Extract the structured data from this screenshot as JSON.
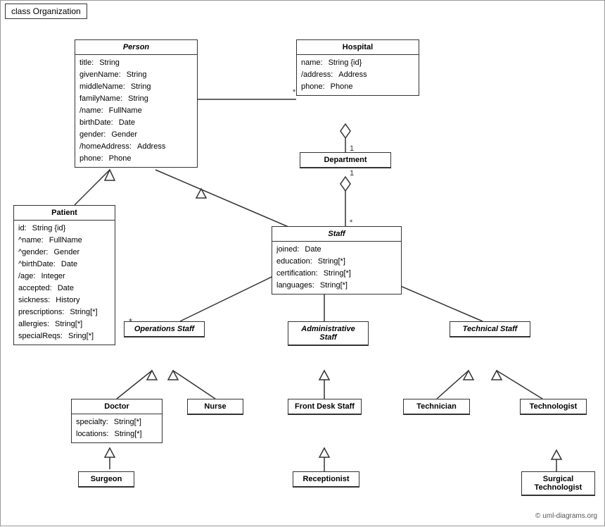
{
  "title": "class Organization",
  "copyright": "© uml-diagrams.org",
  "boxes": {
    "person": {
      "title": "Person",
      "italic": true,
      "attrs": [
        {
          "name": "title:",
          "type": "String"
        },
        {
          "name": "givenName:",
          "type": "String"
        },
        {
          "name": "middleName:",
          "type": "String"
        },
        {
          "name": "familyName:",
          "type": "String"
        },
        {
          "name": "/name:",
          "type": "FullName"
        },
        {
          "name": "birthDate:",
          "type": "Date"
        },
        {
          "name": "gender:",
          "type": "Gender"
        },
        {
          "name": "/homeAddress:",
          "type": "Address"
        },
        {
          "name": "phone:",
          "type": "Phone"
        }
      ]
    },
    "hospital": {
      "title": "Hospital",
      "attrs": [
        {
          "name": "name:",
          "type": "String {id}"
        },
        {
          "name": "/address:",
          "type": "Address"
        },
        {
          "name": "phone:",
          "type": "Phone"
        }
      ]
    },
    "patient": {
      "title": "Patient",
      "attrs": [
        {
          "name": "id:",
          "type": "String {id}"
        },
        {
          "name": "^name:",
          "type": "FullName"
        },
        {
          "name": "^gender:",
          "type": "Gender"
        },
        {
          "name": "^birthDate:",
          "type": "Date"
        },
        {
          "name": "/age:",
          "type": "Integer"
        },
        {
          "name": "accepted:",
          "type": "Date"
        },
        {
          "name": "sickness:",
          "type": "History"
        },
        {
          "name": "prescriptions:",
          "type": "String[*]"
        },
        {
          "name": "allergies:",
          "type": "String[*]"
        },
        {
          "name": "specialReqs:",
          "type": "Sring[*]"
        }
      ]
    },
    "department": {
      "title": "Department",
      "attrs": []
    },
    "staff": {
      "title": "Staff",
      "italic": true,
      "attrs": [
        {
          "name": "joined:",
          "type": "Date"
        },
        {
          "name": "education:",
          "type": "String[*]"
        },
        {
          "name": "certification:",
          "type": "String[*]"
        },
        {
          "name": "languages:",
          "type": "String[*]"
        }
      ]
    },
    "operations_staff": {
      "title": "Operations Staff",
      "italic": true,
      "attrs": []
    },
    "administrative_staff": {
      "title": "Administrative Staff",
      "italic": true,
      "attrs": []
    },
    "technical_staff": {
      "title": "Technical Staff",
      "italic": true,
      "attrs": []
    },
    "doctor": {
      "title": "Doctor",
      "attrs": [
        {
          "name": "specialty:",
          "type": "String[*]"
        },
        {
          "name": "locations:",
          "type": "String[*]"
        }
      ]
    },
    "nurse": {
      "title": "Nurse",
      "attrs": []
    },
    "front_desk_staff": {
      "title": "Front Desk Staff",
      "attrs": []
    },
    "technician": {
      "title": "Technician",
      "attrs": []
    },
    "technologist": {
      "title": "Technologist",
      "attrs": []
    },
    "surgeon": {
      "title": "Surgeon",
      "attrs": []
    },
    "receptionist": {
      "title": "Receptionist",
      "attrs": []
    },
    "surgical_technologist": {
      "title": "Surgical Technologist",
      "attrs": []
    }
  }
}
